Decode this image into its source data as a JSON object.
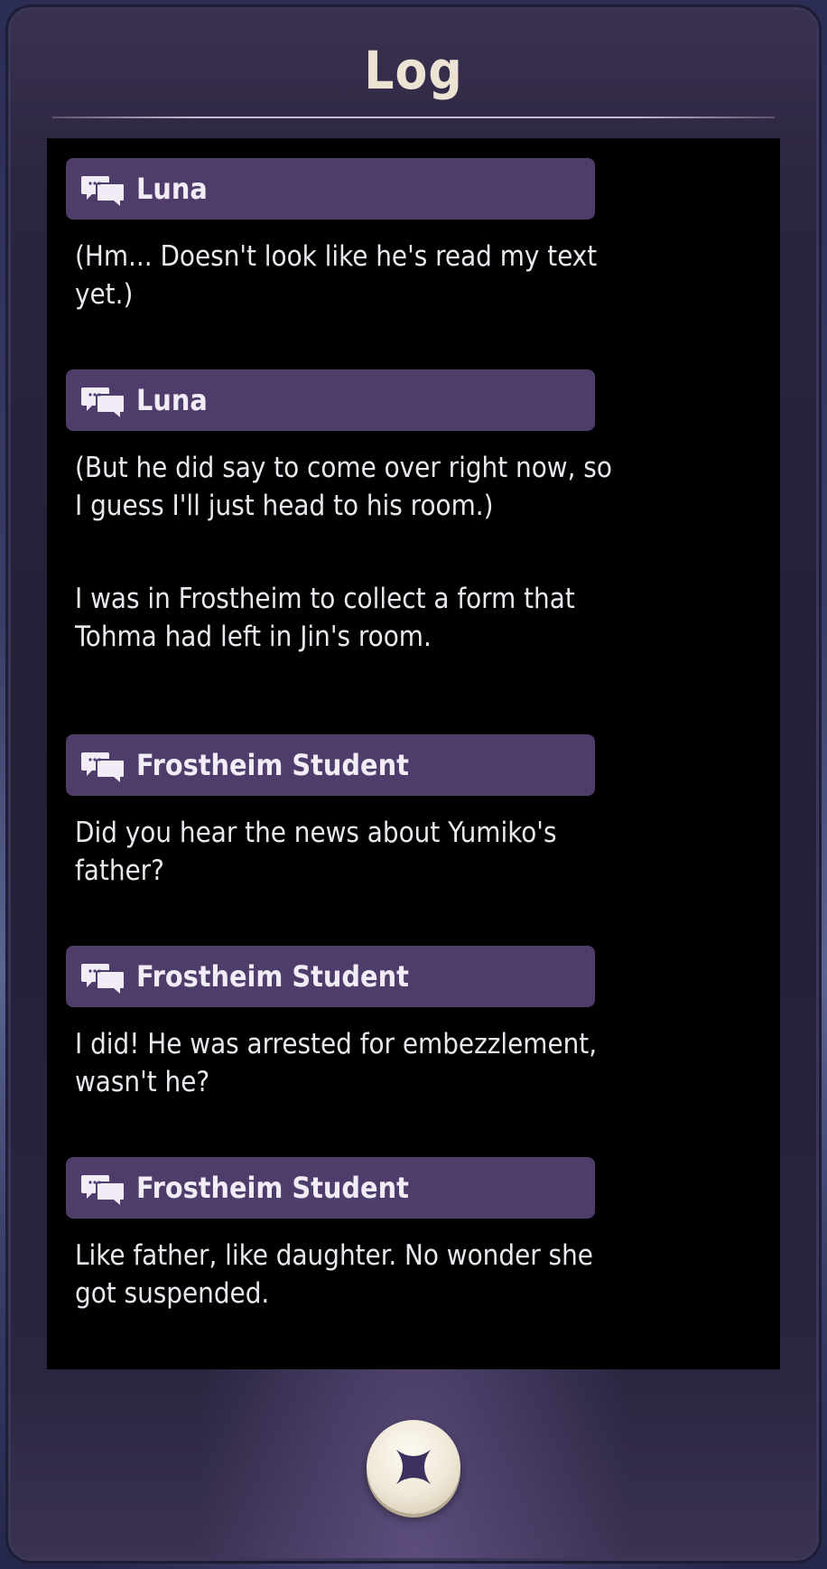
{
  "panel": {
    "title": "Log"
  },
  "log": {
    "entries": [
      {
        "speaker": "Luna",
        "icon": "chat-bubbles-icon",
        "text": "(Hm... Doesn't look like he's read my text yet.)"
      },
      {
        "speaker": "Luna",
        "icon": "chat-bubbles-icon",
        "text": "(But he did say to come over right now, so I guess I'll just head to his room.)"
      },
      {
        "speaker": "",
        "text": "I was in Frostheim to collect a form that Tohma had left in Jin's room."
      },
      {
        "speaker": "Frostheim Student",
        "icon": "chat-bubbles-icon",
        "text": "Did you hear the news about Yumiko's father?"
      },
      {
        "speaker": "Frostheim Student",
        "icon": "chat-bubbles-icon",
        "text": "I did! He was arrested for embezzlement, wasn't he?"
      },
      {
        "speaker": "Frostheim Student",
        "icon": "chat-bubbles-icon",
        "text": "Like father, like daughter. No wonder she got suspended."
      }
    ]
  },
  "close_button": {
    "icon": "close-x-icon"
  },
  "colors": {
    "speaker_bar": "#4e3d6b",
    "log_background": "#000000",
    "title": "#ece3d2",
    "text": "#ece7ef",
    "close_icon": "#3e3160"
  }
}
